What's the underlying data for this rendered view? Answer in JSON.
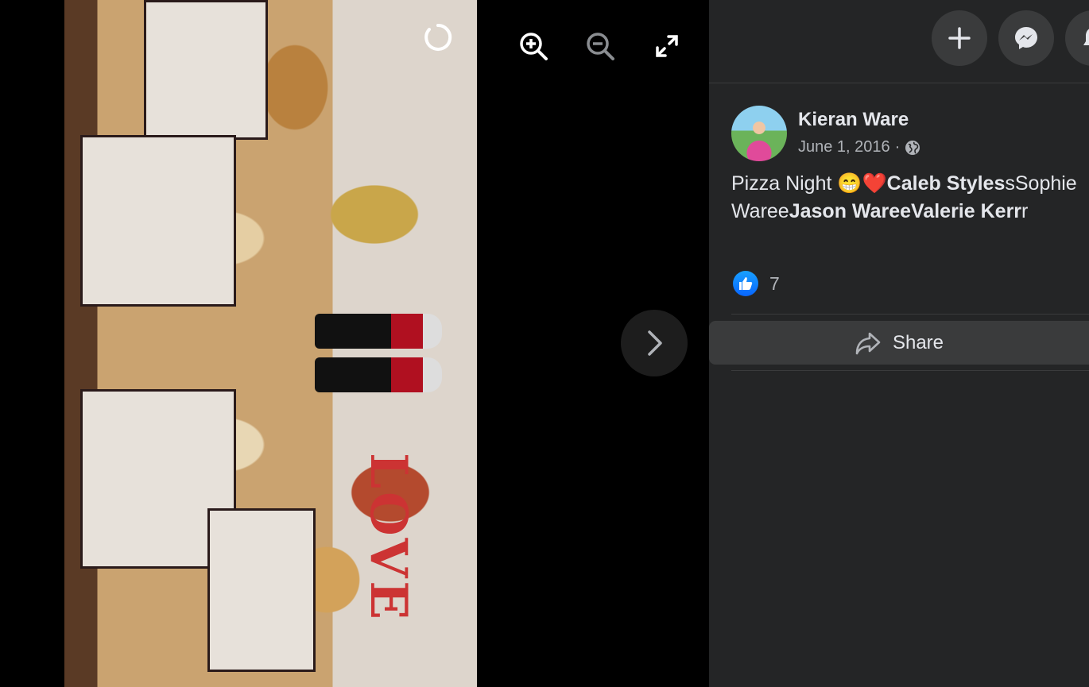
{
  "viewer": {
    "photo_alt": "",
    "tools": [
      "loading-icon",
      "zoom-in-icon",
      "zoom-out-icon",
      "fullscreen-icon"
    ],
    "next_icon": "chevron-right-icon"
  },
  "topbar": {
    "buttons": [
      "plus-icon",
      "messenger-icon",
      "notifications-icon"
    ]
  },
  "post": {
    "author": "Kieran Ware",
    "date": "June 1, 2016",
    "separator": "·",
    "audience_icon": "globe-icon",
    "caption": {
      "prefix": "Pizza Night ",
      "emoji1": "😁",
      "emoji2": "❤️",
      "tag1": "Caleb Styles",
      "text1": "sSophie Waree",
      "tag2": "Jason Waree",
      "tag3": "Valerie Kerr",
      "suffix": "r"
    },
    "reaction_count": "7",
    "share_label": "Share"
  },
  "colors": {
    "panel_bg": "#242526",
    "button_bg": "#3a3b3c",
    "text_primary": "#e4e6eb",
    "text_secondary": "#b0b3b8",
    "like_blue": "#0866ff"
  }
}
